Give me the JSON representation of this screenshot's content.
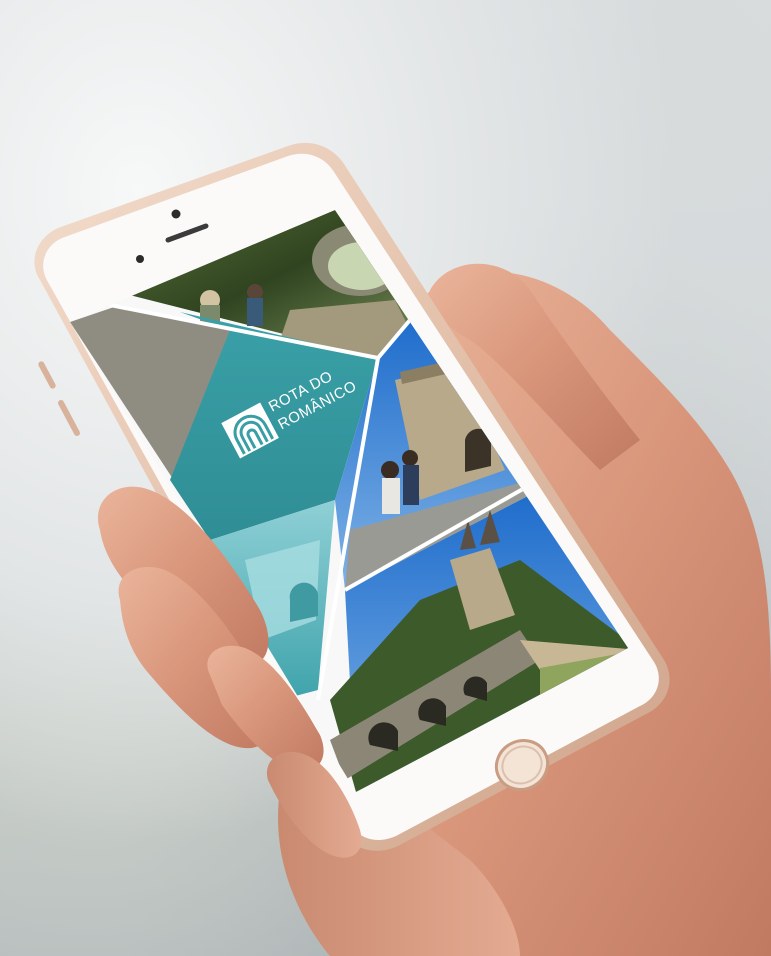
{
  "app": {
    "brand_line1": "ROTA DO",
    "brand_line2": "ROMÂNICO",
    "logo_icon": "romanesque-arch-icon",
    "accent_color": "#3a9ea5",
    "panel_gray": "#8f8d82"
  },
  "device": {
    "model": "smartphone",
    "frame_color": "#ecd4c3",
    "home_button_icon": "home-button-icon"
  }
}
